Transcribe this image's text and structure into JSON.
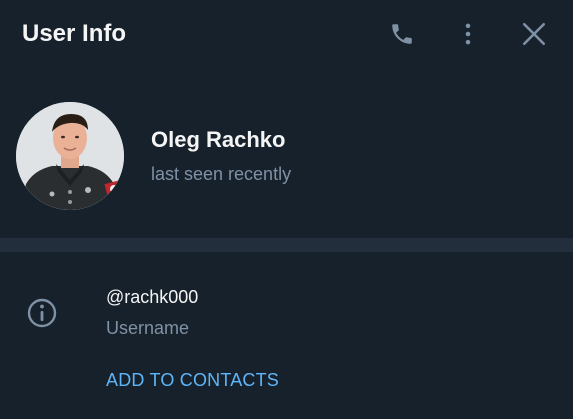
{
  "header": {
    "title": "User Info",
    "icons": [
      "phone-icon",
      "more-vertical-icon",
      "close-icon"
    ]
  },
  "profile": {
    "name": "Oleg Rachko",
    "status": "last seen recently"
  },
  "info": {
    "username": "@rachk000",
    "username_label": "Username",
    "add_contacts_label": "ADD TO CONTACTS"
  },
  "colors": {
    "background": "#17212b",
    "divider": "#232e3c",
    "primary_text": "#f5f5f5",
    "secondary_text": "#7f91a4",
    "icon": "#7f91a4",
    "accent": "#5eb5f7"
  }
}
